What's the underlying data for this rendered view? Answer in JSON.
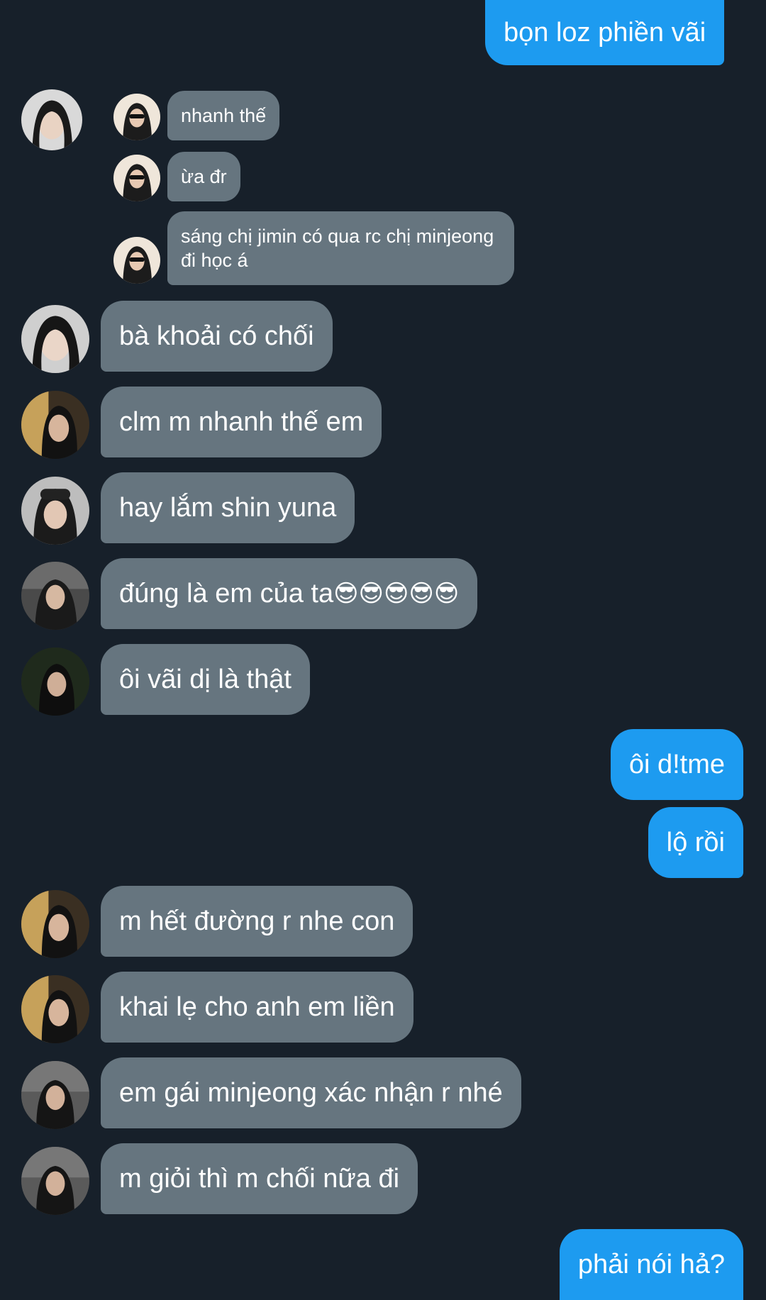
{
  "conversation": {
    "messages": [
      {
        "side": "out",
        "text": "bọn loz phiền vãi"
      },
      {
        "side": "in",
        "text": "nhanh thế",
        "style": "small"
      },
      {
        "side": "in",
        "text": "ừa đr",
        "style": "small"
      },
      {
        "side": "in",
        "text": "sáng chị jimin có qua rc chị minjeong đi học á",
        "style": "small"
      },
      {
        "side": "in",
        "text": "bà khoải có chối"
      },
      {
        "side": "in",
        "text": "clm m nhanh thế em"
      },
      {
        "side": "in",
        "text": "hay lắm shin yuna"
      },
      {
        "side": "in",
        "text": "đúng là em của ta",
        "emoji": "😎😎😎😎😎"
      },
      {
        "side": "in",
        "text": "ôi vãi dị là thật"
      },
      {
        "side": "out",
        "text": "ôi d!tme"
      },
      {
        "side": "out",
        "text": "lộ rồi"
      },
      {
        "side": "in",
        "text": "m hết đường r nhe con"
      },
      {
        "side": "in",
        "text": "khai lẹ cho anh em liền"
      },
      {
        "side": "in",
        "text": "em gái minjeong xác nhận r nhé"
      },
      {
        "side": "in",
        "text": "m giỏi thì m chối nữa đi"
      },
      {
        "side": "out",
        "text": "phải nói hả?"
      }
    ]
  },
  "colors": {
    "background": "#17202a",
    "incoming_bubble": "#66757f",
    "outgoing_bubble": "#1d9bf0"
  }
}
